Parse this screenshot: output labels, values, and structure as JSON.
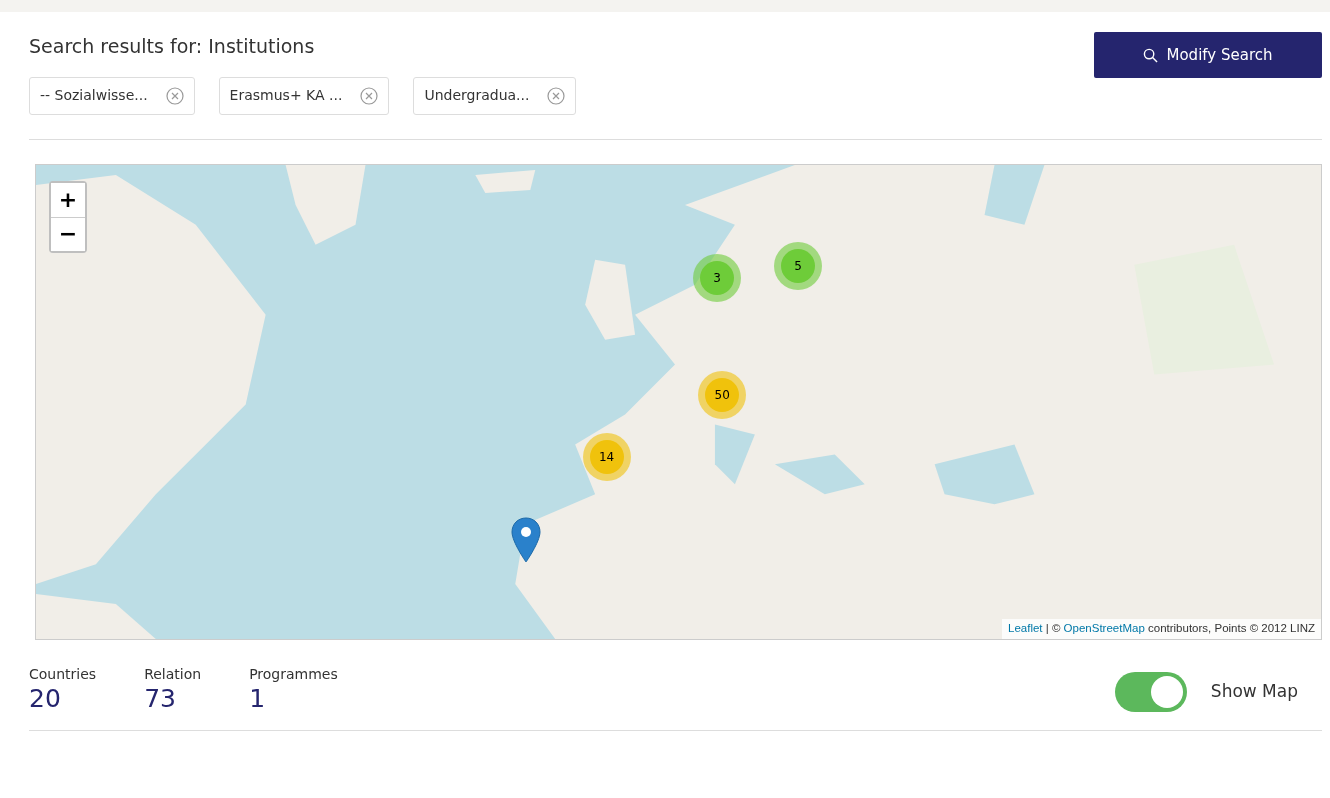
{
  "header": {
    "title": "Search results for: Institutions",
    "button": "Modify Search"
  },
  "filters": [
    {
      "label": "-- Sozialwisse..."
    },
    {
      "label": "Erasmus+ KA ..."
    },
    {
      "label": "Undergradua..."
    }
  ],
  "map": {
    "zoom_in": "+",
    "zoom_out": "−",
    "clusters": [
      {
        "count": "3",
        "color": "#6ecc39"
      },
      {
        "count": "5",
        "color": "#6ecc39"
      },
      {
        "count": "50",
        "color": "#f0c20c"
      },
      {
        "count": "14",
        "color": "#f0c20c"
      }
    ],
    "attribution": {
      "link1": "Leaflet",
      "sep": "|",
      "text1": "©",
      "link2": "OpenStreetMap",
      "text2": "contributors, Points © 2012 LINZ"
    }
  },
  "stats": [
    {
      "label": "Countries",
      "value": "20"
    },
    {
      "label": "Relation",
      "value": "73"
    },
    {
      "label": "Programmes",
      "value": "1"
    }
  ],
  "toggle": {
    "label": "Show Map",
    "on": true
  }
}
